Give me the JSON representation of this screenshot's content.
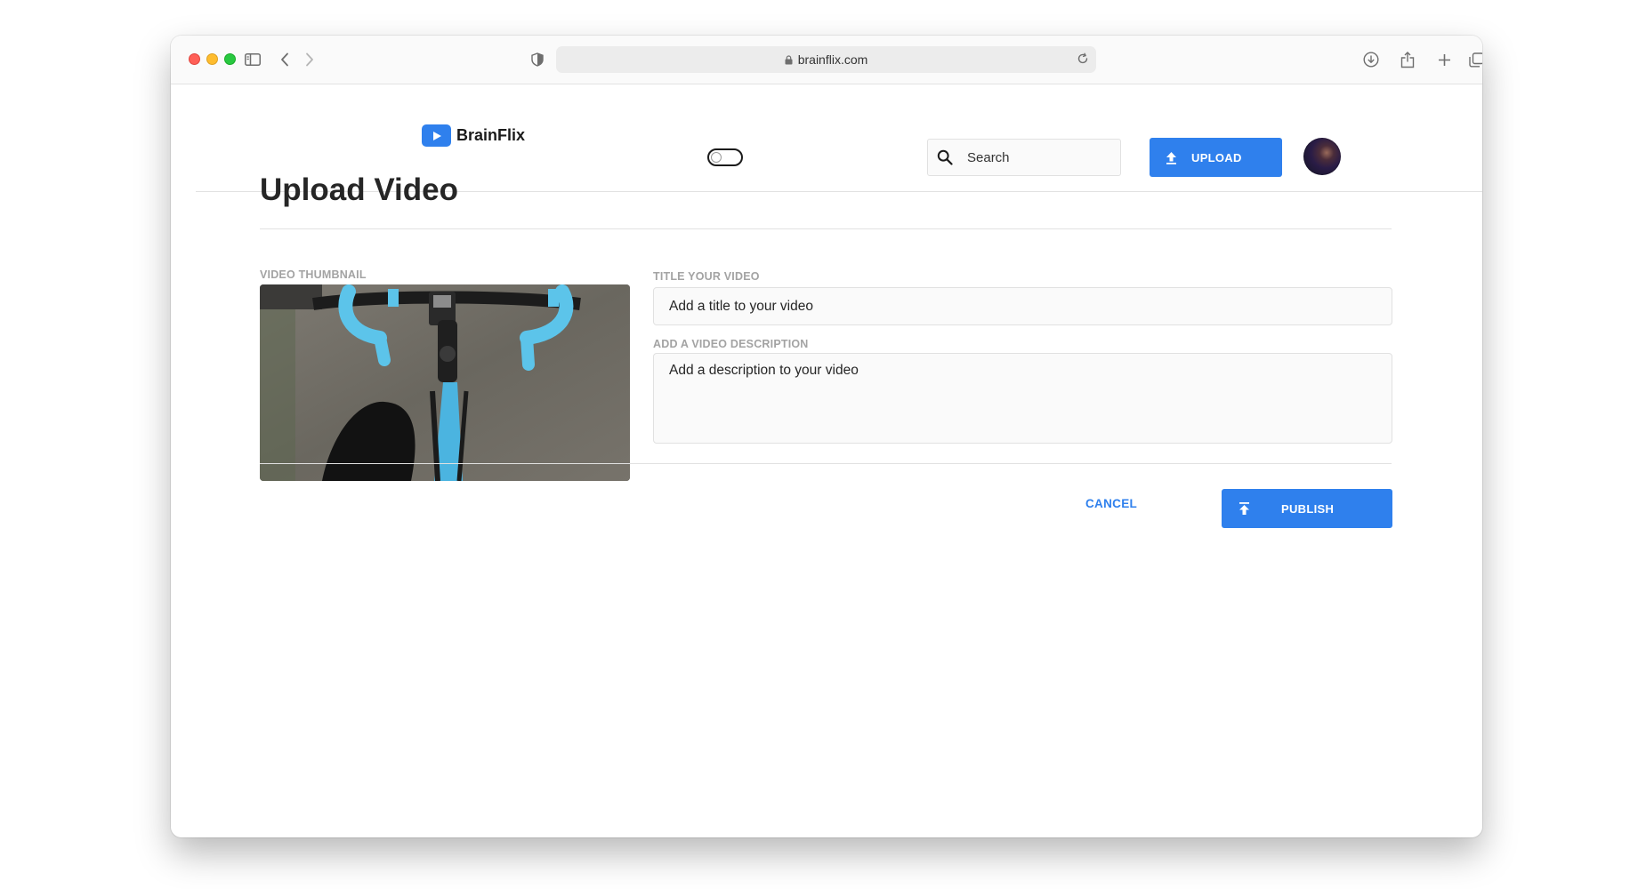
{
  "browser": {
    "url": "brainflix.com",
    "icons": [
      "sidebar-icon",
      "back-icon",
      "forward-icon",
      "shield-icon",
      "lock-icon",
      "reload-icon",
      "download-icon",
      "share-icon",
      "new-tab-icon",
      "tabs-overview-icon"
    ]
  },
  "header": {
    "logo_text": "BrainFlix",
    "search": {
      "placeholder": "Search"
    },
    "upload_label": "UPLOAD",
    "theme_toggle_on": false
  },
  "page": {
    "title": "Upload Video",
    "thumbnail_label": "VIDEO THUMBNAIL",
    "title_label": "TITLE YOUR VIDEO",
    "title_placeholder": "Add a title to your video",
    "description_label": "ADD A VIDEO DESCRIPTION",
    "description_placeholder": "Add a description to your video",
    "cancel_label": "CANCEL",
    "publish_label": "PUBLISH"
  },
  "colors": {
    "accent": "#2f80ed",
    "text": "#262626",
    "label": "#a3a3a3",
    "border": "#e1e1e1",
    "field_bg": "#fafafa"
  }
}
